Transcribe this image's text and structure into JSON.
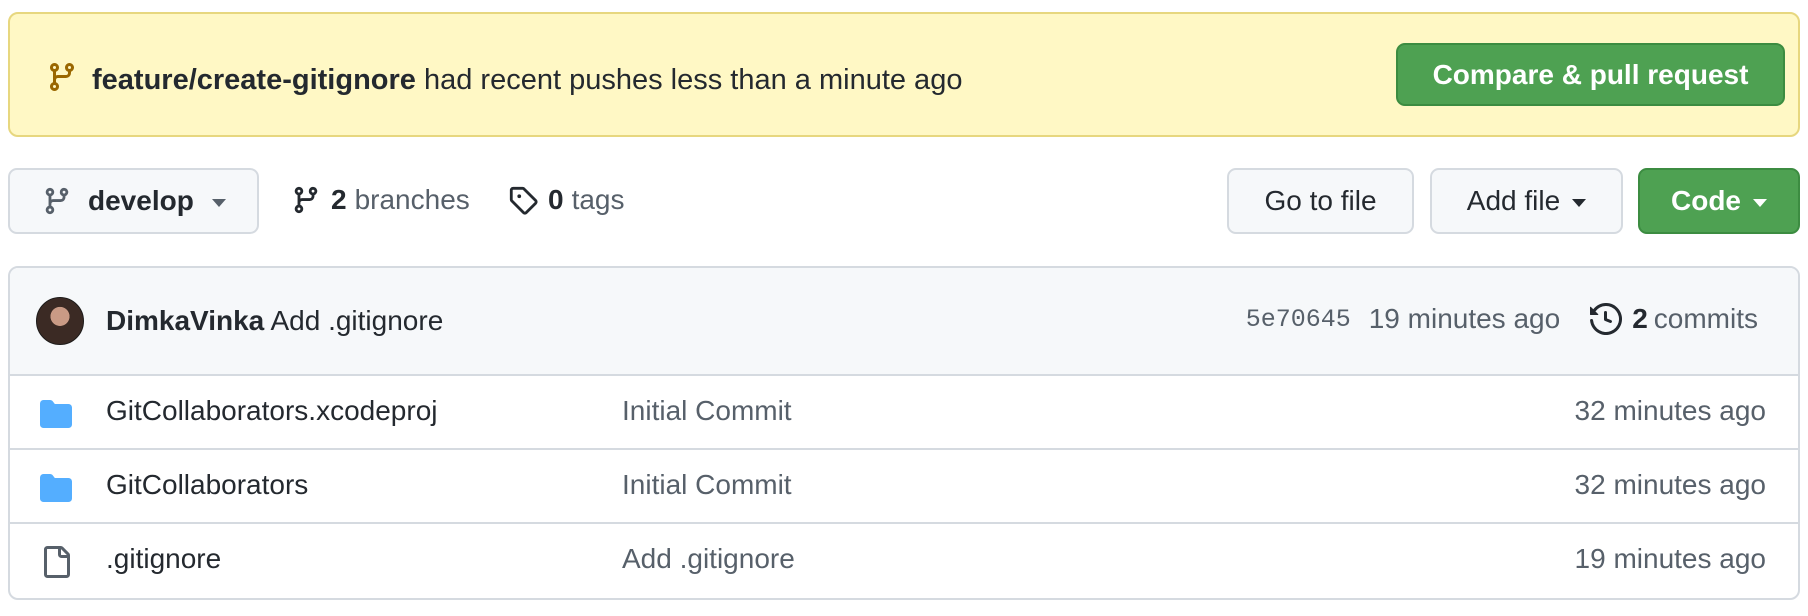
{
  "banner": {
    "branch": "feature/create-gitignore",
    "message": " had recent pushes less than a minute ago",
    "compare_button": "Compare & pull request",
    "icon": "git-branch-icon"
  },
  "toolbar": {
    "branch_selector": "develop",
    "branches_count": "2",
    "branches_label": "branches",
    "tags_count": "0",
    "tags_label": "tags",
    "go_to_file": "Go to file",
    "add_file": "Add file",
    "code": "Code"
  },
  "latest_commit": {
    "author": "DimkaVinka",
    "message": "Add .gitignore",
    "sha": "5e70645",
    "time": "19 minutes ago",
    "commit_count": "2",
    "commits_label": "commits"
  },
  "files": [
    {
      "name": "GitCollaborators.xcodeproj",
      "type": "folder",
      "message": "Initial Commit",
      "age": "32 minutes ago"
    },
    {
      "name": "GitCollaborators",
      "type": "folder",
      "message": "Initial Commit",
      "age": "32 minutes ago"
    },
    {
      "name": ".gitignore",
      "type": "file",
      "message": "Add .gitignore",
      "age": "19 minutes ago"
    }
  ],
  "colors": {
    "banner_bg": "#fff8c5",
    "primary_green": "#4ea152",
    "folder_blue": "#54aeff",
    "muted_text": "#57606a"
  }
}
